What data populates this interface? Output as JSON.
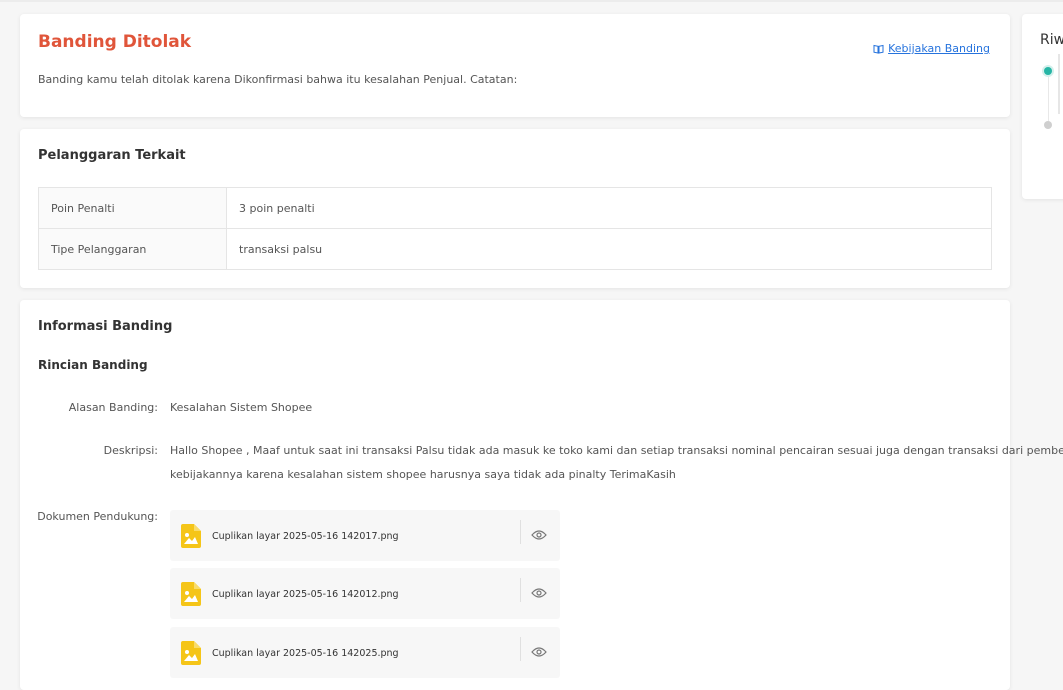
{
  "status": {
    "title": "Banding Ditolak",
    "policy_link": "Kebijakan Banding",
    "text": "Banding kamu telah ditolak karena Dikonfirmasi bahwa itu kesalahan Penjual. Catatan:"
  },
  "violation": {
    "title": "Pelanggaran Terkait",
    "rows": [
      {
        "label": "Poin Penalti",
        "value": "3 poin penalti"
      },
      {
        "label": "Tipe Pelanggaran",
        "value": "transaksi palsu"
      }
    ]
  },
  "info": {
    "title": "Informasi Banding",
    "subtitle": "Rincian Banding",
    "reason_label": "Alasan Banding:",
    "reason_value": "Kesalahan Sistem Shopee",
    "desc_label": "Deskripsi:",
    "desc_line1": "Hallo Shopee , Maaf untuk saat ini transaksi Palsu tidak ada masuk ke toko kami dan setiap transaksi nominal pencairan sesuai juga dengan transaksi dari pembeli ,mohon",
    "desc_line2": "kebijakannya karena kesalahan sistem shopee harusnya saya tidak ada pinalty TerimaKasih",
    "docs_label": "Dokumen Pendukung:",
    "documents": [
      {
        "name": "Cuplikan layar 2025-05-16 142017.png"
      },
      {
        "name": "Cuplikan layar 2025-05-16 142012.png"
      },
      {
        "name": "Cuplikan layar 2025-05-16 142025.png"
      }
    ]
  },
  "history": {
    "title": "Riw"
  },
  "colors": {
    "accent_red": "#e0553a",
    "link_blue": "#2673dd",
    "timeline_active": "#26b5a5",
    "file_icon": "#f5c518"
  },
  "icons": [
    "book-icon",
    "image-file-icon",
    "eye-icon"
  ]
}
